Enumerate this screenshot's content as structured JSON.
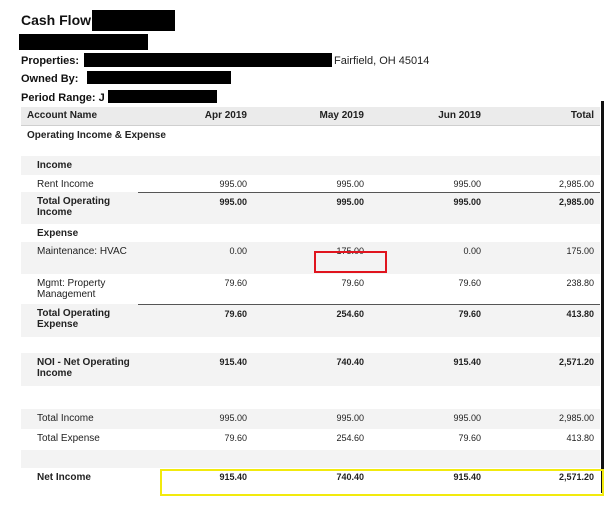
{
  "report": {
    "title": "Cash Flow",
    "properties_label": "Properties:",
    "properties_location": "Fairfield, OH 45014",
    "owned_by_label": "Owned By:",
    "period_label": "Period Range: J"
  },
  "table": {
    "columns": [
      "Account Name",
      "Apr 2019",
      "May 2019",
      "Jun 2019",
      "Total"
    ],
    "sections": {
      "operating": "Operating Income & Expense",
      "income": "Income",
      "expense": "Expense"
    },
    "rows": {
      "rent_income": {
        "label": "Rent Income",
        "values": [
          "995.00",
          "995.00",
          "995.00",
          "2,985.00"
        ]
      },
      "total_operating_income": {
        "label": "Total Operating Income",
        "values": [
          "995.00",
          "995.00",
          "995.00",
          "2,985.00"
        ]
      },
      "maintenance_hvac": {
        "label": "Maintenance: HVAC",
        "values": [
          "0.00",
          "175.00",
          "0.00",
          "175.00"
        ]
      },
      "mgmt_property": {
        "label": "Mgmt: Property Management",
        "values": [
          "79.60",
          "79.60",
          "79.60",
          "238.80"
        ]
      },
      "total_operating_expense": {
        "label": "Total Operating Expense",
        "values": [
          "79.60",
          "254.60",
          "79.60",
          "413.80"
        ]
      },
      "noi": {
        "label": "NOI - Net Operating Income",
        "values": [
          "915.40",
          "740.40",
          "915.40",
          "2,571.20"
        ]
      },
      "total_income": {
        "label": "Total Income",
        "values": [
          "995.00",
          "995.00",
          "995.00",
          "2,985.00"
        ]
      },
      "total_expense": {
        "label": "Total Expense",
        "values": [
          "79.60",
          "254.60",
          "79.60",
          "413.80"
        ]
      },
      "net_income": {
        "label": "Net Income",
        "values": [
          "915.40",
          "740.40",
          "915.40",
          "2,571.20"
        ]
      }
    }
  },
  "colors": {
    "highlight_red": "#e0141e",
    "highlight_yellow": "#f2ea0d",
    "header_bg": "#ebebeb"
  }
}
